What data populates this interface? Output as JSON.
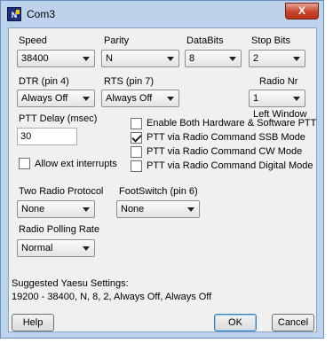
{
  "window": {
    "title": "Com3",
    "app_icon": "N1MM-logo-icon",
    "close_label": "X"
  },
  "speed": {
    "label": "Speed",
    "value": "38400"
  },
  "parity": {
    "label": "Parity",
    "value": "N"
  },
  "databits": {
    "label": "DataBits",
    "value": "8"
  },
  "stopbits": {
    "label": "Stop Bits",
    "value": "2"
  },
  "dtr": {
    "label": "DTR (pin 4)",
    "value": "Always Off"
  },
  "rts": {
    "label": "RTS (pin 7)",
    "value": "Always Off"
  },
  "radio_nr": {
    "label": "Radio Nr",
    "value": "1",
    "note": "Left Window"
  },
  "ptt_delay": {
    "label": "PTT Delay  (msec)",
    "value": "30"
  },
  "allow_interrupts": {
    "label": "Allow ext interrupts",
    "checked": false
  },
  "options": [
    {
      "label": "Enable Both Hardware & Software PTT",
      "checked": false
    },
    {
      "label": "PTT via Radio Command SSB Mode",
      "checked": true
    },
    {
      "label": "PTT via Radio Command CW Mode",
      "checked": false
    },
    {
      "label": "PTT via Radio Command Digital Mode",
      "checked": false
    }
  ],
  "two_radio": {
    "label": "Two Radio Protocol",
    "value": "None"
  },
  "footswitch": {
    "label": "FootSwitch (pin 6)",
    "value": "None"
  },
  "polling": {
    "label": "Radio Polling Rate",
    "value": "Normal"
  },
  "suggested": {
    "title": "Suggested Yaesu Settings:",
    "text": "19200 - 38400, N, 8, 2, Always Off, Always Off"
  },
  "buttons": {
    "help": "Help",
    "ok": "OK",
    "cancel": "Cancel"
  }
}
